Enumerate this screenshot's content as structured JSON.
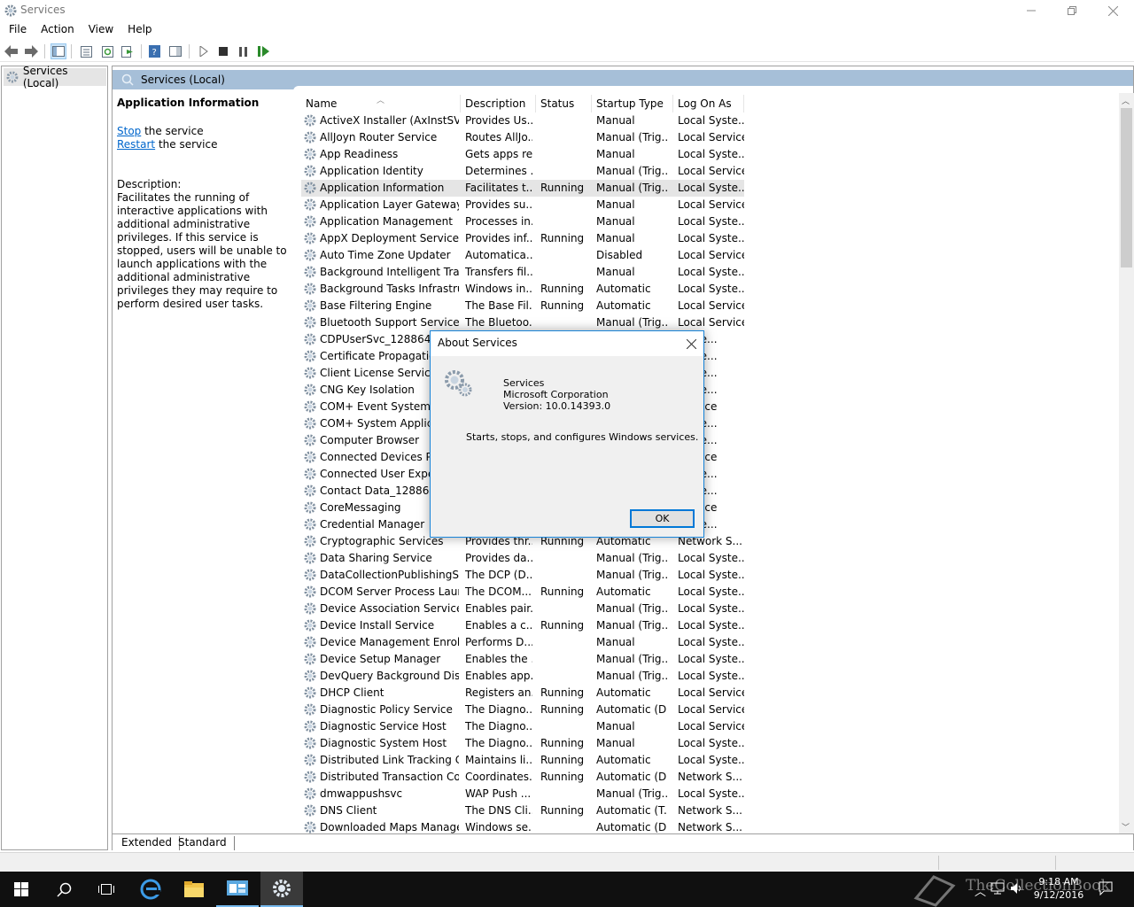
{
  "window": {
    "title": "Services"
  },
  "menu": [
    "File",
    "Action",
    "View",
    "Help"
  ],
  "tree": {
    "root_label": "Services (Local)"
  },
  "pane": {
    "header": "Services (Local)",
    "info_title": "Application Information",
    "stop_link": "Stop",
    "stop_suffix": " the service",
    "restart_link": "Restart",
    "restart_suffix": " the service",
    "description_label": "Description:",
    "description_text": "Facilitates the running of interactive applications with additional administrative privileges.  If this service is stopped, users will be unable to launch applications with the additional administrative privileges they may require to perform desired user tasks."
  },
  "columns": [
    "Name",
    "Description",
    "Status",
    "Startup Type",
    "Log On As"
  ],
  "services": [
    [
      "ActiveX Installer (AxInstSV)",
      "Provides Us...",
      "",
      "Manual",
      "Local Syste..."
    ],
    [
      "AllJoyn Router Service",
      "Routes AllJo...",
      "",
      "Manual (Trig...",
      "Local Service"
    ],
    [
      "App Readiness",
      "Gets apps re...",
      "",
      "Manual",
      "Local Syste..."
    ],
    [
      "Application Identity",
      "Determines ...",
      "",
      "Manual (Trig...",
      "Local Service"
    ],
    [
      "Application Information",
      "Facilitates t...",
      "Running",
      "Manual (Trig...",
      "Local Syste..."
    ],
    [
      "Application Layer Gateway ...",
      "Provides su...",
      "",
      "Manual",
      "Local Service"
    ],
    [
      "Application Management",
      "Processes in...",
      "",
      "Manual",
      "Local Syste..."
    ],
    [
      "AppX Deployment Service (...",
      "Provides inf...",
      "Running",
      "Manual",
      "Local Syste..."
    ],
    [
      "Auto Time Zone Updater",
      "Automatica...",
      "",
      "Disabled",
      "Local Service"
    ],
    [
      "Background Intelligent Tran...",
      "Transfers fil...",
      "",
      "Manual",
      "Local Syste..."
    ],
    [
      "Background Tasks Infrastru...",
      "Windows in...",
      "Running",
      "Automatic",
      "Local Syste..."
    ],
    [
      "Base Filtering Engine",
      "The Base Fil...",
      "Running",
      "Automatic",
      "Local Service"
    ],
    [
      "Bluetooth Support Service",
      "The Bluetoo...",
      "",
      "Manual (Trig...",
      "Local Service"
    ],
    [
      "CDPUserSvc_128864",
      "",
      "",
      "",
      "Syste..."
    ],
    [
      "Certificate Propagation",
      "",
      "",
      "",
      "Syste..."
    ],
    [
      "Client License Service (C",
      "",
      "",
      "",
      "Syste..."
    ],
    [
      "CNG Key Isolation",
      "",
      "",
      "",
      "Syste..."
    ],
    [
      "COM+ Event System",
      "",
      "",
      "",
      "Service"
    ],
    [
      "COM+ System Applicat",
      "",
      "",
      "",
      "Syste..."
    ],
    [
      "Computer Browser",
      "",
      "",
      "",
      "Syste..."
    ],
    [
      "Connected Devices Plat",
      "",
      "",
      "",
      "Service"
    ],
    [
      "Connected User Experie",
      "",
      "",
      "",
      "Syste..."
    ],
    [
      "Contact Data_128864",
      "",
      "",
      "",
      "Syste..."
    ],
    [
      "CoreMessaging",
      "",
      "",
      "",
      "Service"
    ],
    [
      "Credential Manager",
      "",
      "",
      "",
      "Syste..."
    ],
    [
      "Cryptographic Services",
      "Provides thr...",
      "Running",
      "Automatic",
      "Network S..."
    ],
    [
      "Data Sharing Service",
      "Provides da...",
      "",
      "Manual (Trig...",
      "Local Syste..."
    ],
    [
      "DataCollectionPublishingSe...",
      "The DCP (D...",
      "",
      "Manual (Trig...",
      "Local Syste..."
    ],
    [
      "DCOM Server Process Laun...",
      "The DCOM...",
      "Running",
      "Automatic",
      "Local Syste..."
    ],
    [
      "Device Association Service",
      "Enables pair...",
      "",
      "Manual (Trig...",
      "Local Syste..."
    ],
    [
      "Device Install Service",
      "Enables a c...",
      "Running",
      "Manual (Trig...",
      "Local Syste..."
    ],
    [
      "Device Management Enroll...",
      "Performs D...",
      "",
      "Manual",
      "Local Syste..."
    ],
    [
      "Device Setup Manager",
      "Enables the ...",
      "",
      "Manual (Trig...",
      "Local Syste..."
    ],
    [
      "DevQuery Background Disc...",
      "Enables app...",
      "",
      "Manual (Trig...",
      "Local Syste..."
    ],
    [
      "DHCP Client",
      "Registers an...",
      "Running",
      "Automatic",
      "Local Service"
    ],
    [
      "Diagnostic Policy Service",
      "The Diagno...",
      "Running",
      "Automatic (D...",
      "Local Service"
    ],
    [
      "Diagnostic Service Host",
      "The Diagno...",
      "",
      "Manual",
      "Local Service"
    ],
    [
      "Diagnostic System Host",
      "The Diagno...",
      "Running",
      "Manual",
      "Local Syste..."
    ],
    [
      "Distributed Link Tracking Cl...",
      "Maintains li...",
      "Running",
      "Automatic",
      "Local Syste..."
    ],
    [
      "Distributed Transaction Coo...",
      "Coordinates...",
      "Running",
      "Automatic (D...",
      "Network S..."
    ],
    [
      "dmwappushsvc",
      "WAP Push ...",
      "",
      "Manual (Trig...",
      "Local Syste..."
    ],
    [
      "DNS Client",
      "The DNS Cli...",
      "Running",
      "Automatic (T...",
      "Network S..."
    ],
    [
      "Downloaded Maps Manager",
      "Windows se...",
      "",
      "Automatic (D...",
      "Network S..."
    ]
  ],
  "selected_index": 4,
  "tabs": [
    "Extended",
    "Standard"
  ],
  "dialog": {
    "title": "About Services",
    "product": "Services",
    "company": "Microsoft Corporation",
    "version": "Version: 10.0.14393.0",
    "description": "Starts, stops, and configures Windows services.",
    "ok_label": "OK"
  },
  "taskbar": {
    "time": "9:18 AM",
    "date": "9/12/2016",
    "watermark": "TheCollectionBook"
  },
  "colors": {
    "accent": "#0078d7",
    "header": "#a6bfd8",
    "link": "#0066cc"
  }
}
